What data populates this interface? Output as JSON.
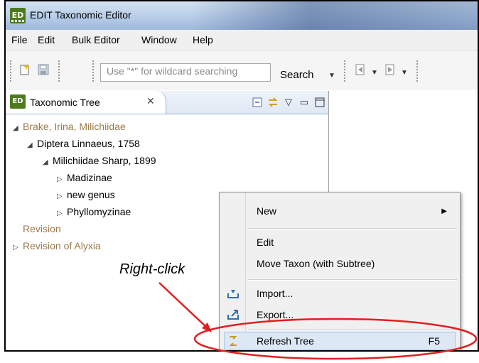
{
  "window": {
    "title": "EDIT Taxonomic Editor",
    "icon": "ED"
  },
  "menubar": {
    "items": [
      "File",
      "Edit",
      "Bulk Editor",
      "Window",
      "Help"
    ]
  },
  "toolbar": {
    "search_placeholder": "Use \"*\" for wildcard searching",
    "search_button": "Search"
  },
  "view": {
    "tab_label": "Taxonomic Tree",
    "tab_icon": "ED",
    "close_glyph": "✕"
  },
  "tree": {
    "nodes": [
      {
        "label": "Brake, Irina, Milichiidae",
        "toggle": "◢"
      },
      {
        "label": "Diptera Linnaeus, 1758",
        "toggle": "◢"
      },
      {
        "label": "Milichiidae Sharp, 1899",
        "toggle": "◢"
      },
      {
        "label": "Madizinae",
        "toggle": "▷"
      },
      {
        "label": "new genus",
        "toggle": "▷"
      },
      {
        "label": "Phyllomyzinae",
        "toggle": "▷"
      },
      {
        "label": "Revision",
        "toggle": ""
      },
      {
        "label": "Revision of Alyxia",
        "toggle": "▷"
      }
    ]
  },
  "annotation": {
    "text": "Right-click",
    "color": "#e02020"
  },
  "context_menu": {
    "items": [
      {
        "label": "New",
        "submenu": true
      },
      {
        "label": "Edit"
      },
      {
        "label": "Move Taxon (with Subtree)"
      },
      {
        "label": "Import...",
        "icon": "import-icon"
      },
      {
        "label": "Export...",
        "icon": "export-icon"
      },
      {
        "label": "Refresh Tree",
        "shortcut": "F5",
        "icon": "refresh-icon"
      }
    ]
  },
  "colors": {
    "accent_red": "#e02020",
    "tree_brown": "#9b7a4d",
    "icon_green": "#4d7a1f"
  }
}
